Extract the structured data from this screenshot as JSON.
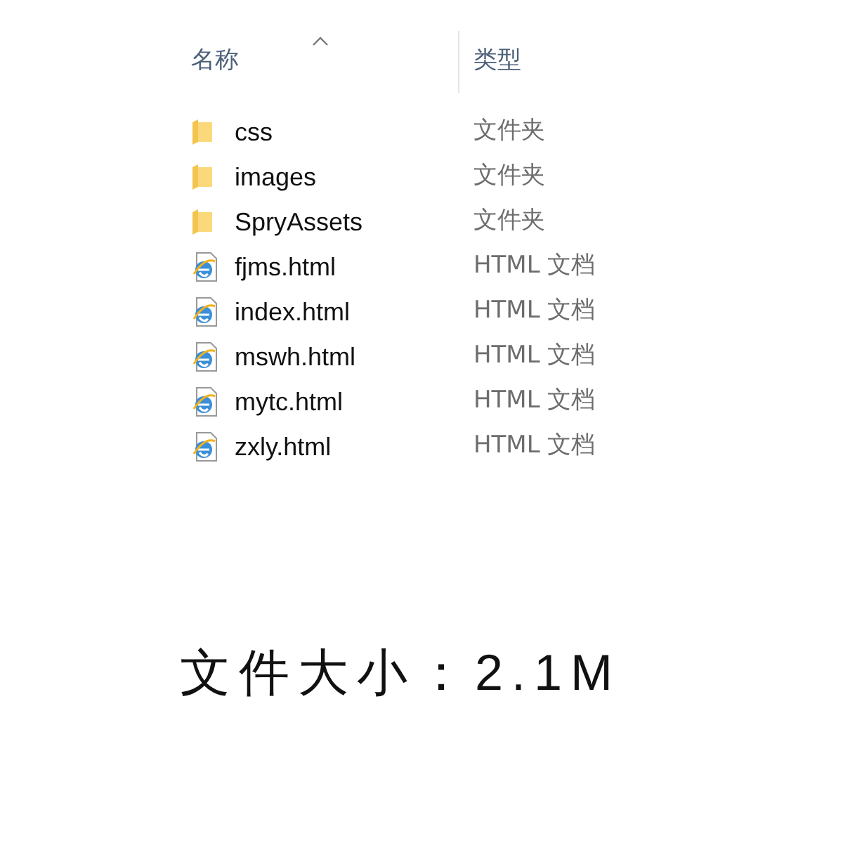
{
  "columns": [
    {
      "label": "名称",
      "sorted": true
    },
    {
      "label": "类型",
      "sorted": false
    }
  ],
  "files": [
    {
      "kind": "folder",
      "name": "css",
      "type": "文件夹"
    },
    {
      "kind": "folder",
      "name": "images",
      "type": "文件夹"
    },
    {
      "kind": "folder",
      "name": "SpryAssets",
      "type": "文件夹"
    },
    {
      "kind": "html",
      "name": "fjms.html",
      "type": "HTML 文档"
    },
    {
      "kind": "html",
      "name": "index.html",
      "type": "HTML 文档"
    },
    {
      "kind": "html",
      "name": "mswh.html",
      "type": "HTML 文档"
    },
    {
      "kind": "html",
      "name": "mytc.html",
      "type": "HTML 文档"
    },
    {
      "kind": "html",
      "name": "zxly.html",
      "type": "HTML 文档"
    }
  ],
  "caption": "文件大小：2.1M"
}
